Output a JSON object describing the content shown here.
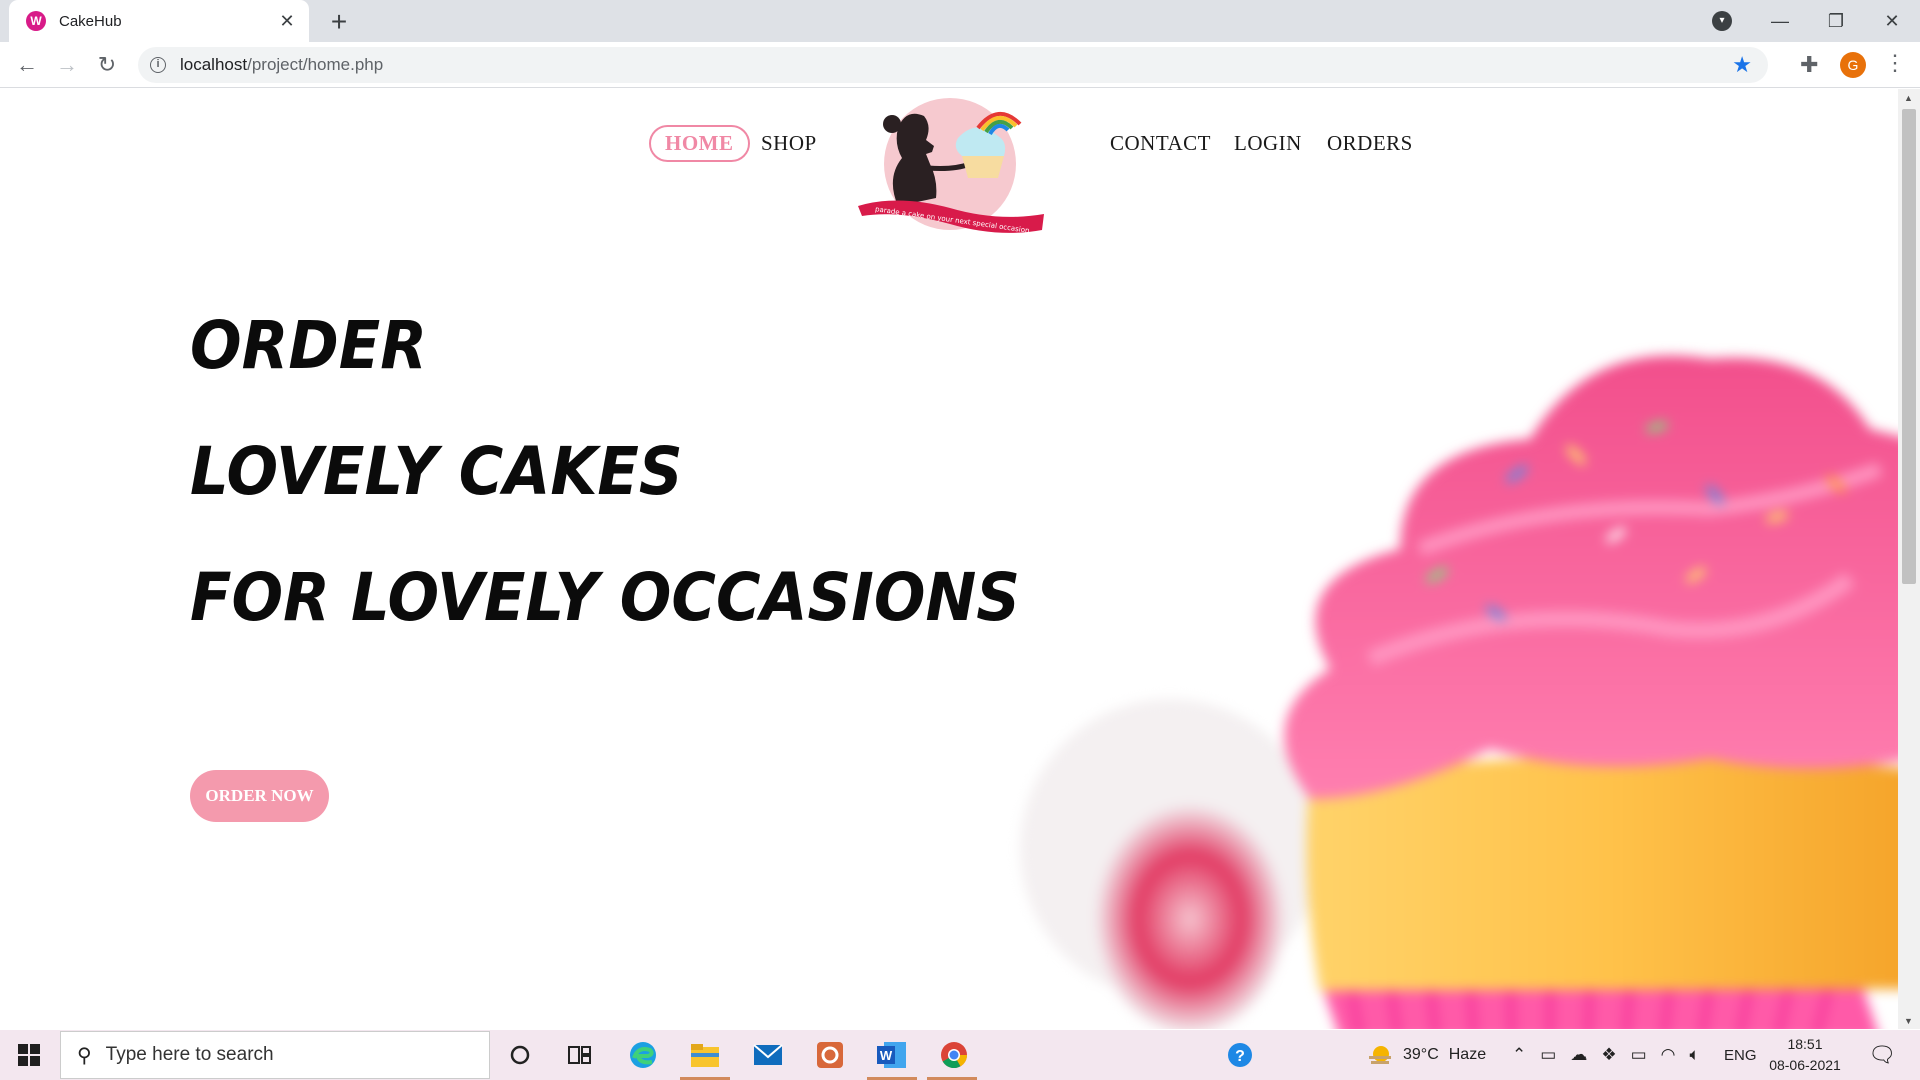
{
  "browser": {
    "tab_title": "CakeHub",
    "favicon_letter": "W",
    "url_host": "localhost",
    "url_path": "/project/home.php",
    "profile_initial": "G"
  },
  "site": {
    "nav": {
      "home": "HOME",
      "shop": "SHOP",
      "contact": "CONTACT",
      "login": "LOGIN",
      "orders": "ORDERS"
    },
    "logo_ribbon_text": "parade a cake on your next special occasion",
    "hero": {
      "line1": "ORDER",
      "line2": "LOVELY CAKES",
      "line3": "FOR LOVELY OCCASIONS",
      "cta": "ORDER NOW"
    },
    "accent_color": "#f088a5"
  },
  "taskbar": {
    "search_placeholder": "Type here to search",
    "weather_temp": "39°C",
    "weather_desc": "Haze",
    "language": "ENG",
    "time": "18:51",
    "date": "08-06-2021"
  }
}
